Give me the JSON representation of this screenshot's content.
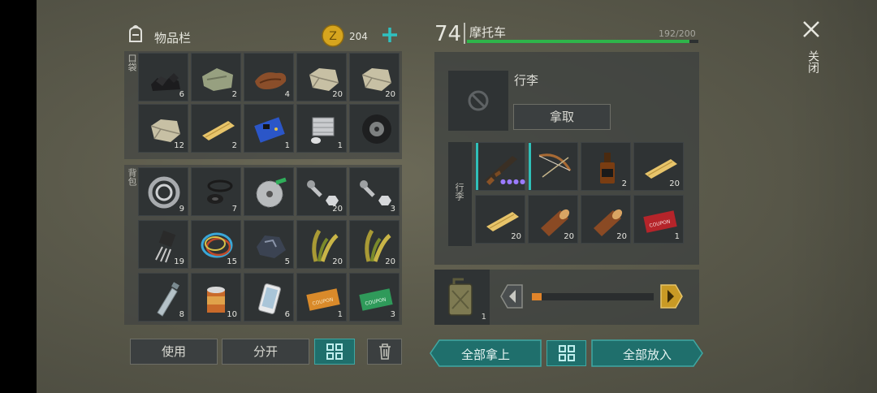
{
  "inventory": {
    "title": "物品栏",
    "coins": "204",
    "pocket_label": "口袋",
    "backpack_label": "背包",
    "pocket_items": [
      {
        "name": "coal-icon",
        "qty": "6"
      },
      {
        "name": "cloth-icon",
        "qty": "2"
      },
      {
        "name": "leather-icon",
        "qty": "4"
      },
      {
        "name": "stone-icon",
        "qty": "20"
      },
      {
        "name": "stone-icon",
        "qty": "20"
      },
      {
        "name": "stone-icon",
        "qty": "12"
      },
      {
        "name": "plank-icon",
        "qty": "2"
      },
      {
        "name": "circuit-board-icon",
        "qty": "1"
      },
      {
        "name": "engine-cylinder-icon",
        "qty": "1"
      },
      {
        "name": "tire-icon",
        "qty": ""
      }
    ],
    "backpack_items": [
      {
        "name": "bearing-icon",
        "qty": "9"
      },
      {
        "name": "rubber-parts-icon",
        "qty": "7"
      },
      {
        "name": "saw-blade-icon",
        "qty": ""
      },
      {
        "name": "bolt-nut-icon",
        "qty": "20"
      },
      {
        "name": "bolt-nut-icon",
        "qty": "3"
      },
      {
        "name": "transistor-icon",
        "qty": "19"
      },
      {
        "name": "wires-icon",
        "qty": "15"
      },
      {
        "name": "ore-icon",
        "qty": "5"
      },
      {
        "name": "plant-fiber-icon",
        "qty": "20"
      },
      {
        "name": "plant-fiber-icon",
        "qty": "20"
      },
      {
        "name": "plastic-bottle-icon",
        "qty": "8"
      },
      {
        "name": "tin-can-icon",
        "qty": "10"
      },
      {
        "name": "smartphone-icon",
        "qty": "6"
      },
      {
        "name": "coupon-orange-icon",
        "qty": "1"
      },
      {
        "name": "coupon-green-icon",
        "qty": "3"
      }
    ],
    "use_label": "使用",
    "split_label": "分开"
  },
  "vehicle": {
    "level": "74",
    "name": "摩托车",
    "durability_text": "192/200",
    "durability": 0.96,
    "luggage_title": "行李",
    "take_label": "拿取",
    "luggage_side_label": "行李",
    "luggage_items": [
      {
        "name": "ak-rifle-icon",
        "qty": ""
      },
      {
        "name": "bow-icon",
        "qty": ""
      },
      {
        "name": "whiskey-bottle-icon",
        "qty": "2"
      },
      {
        "name": "plank-icon",
        "qty": "20"
      },
      {
        "name": "plank-icon",
        "qty": "20"
      },
      {
        "name": "log-icon",
        "qty": "20"
      },
      {
        "name": "log-icon",
        "qty": "20"
      },
      {
        "name": "coupon-red-icon",
        "qty": "1"
      }
    ],
    "fuel_qty": "1",
    "fuel_level": 0.08,
    "take_all_label": "全部拿上",
    "put_all_label": "全部放入"
  },
  "close_label": "关闭"
}
